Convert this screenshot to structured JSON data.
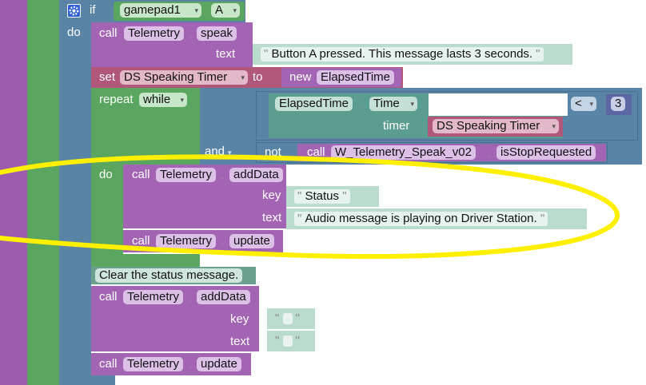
{
  "event": {
    "do_label": "do"
  },
  "if_block": {
    "if_label": "if",
    "do_label": "do",
    "condition": {
      "object": "gamepad1",
      "property": "A"
    }
  },
  "speak_block": {
    "call_label": "call",
    "object": "Telemetry",
    "method": "speak",
    "text_label": "text",
    "text_value": "Button A pressed. This message lasts 3 seconds."
  },
  "set_block": {
    "set_label": "set",
    "variable": "DS Speaking Timer",
    "to_label": "to",
    "new_label": "new",
    "class_name": "ElapsedTime"
  },
  "repeat_block": {
    "repeat_label": "repeat",
    "mode": "while",
    "do_label": "do",
    "compare": {
      "object": "ElapsedTime",
      "property": "Time",
      "timer_label": "timer",
      "timer_value": "DS Speaking Timer",
      "operator": "<",
      "number": "3"
    },
    "and_label": "and",
    "not_label": "not",
    "not_call": {
      "call_label": "call",
      "function": "W_Telemetry_Speak_v02",
      "method": "isStopRequested"
    }
  },
  "loop_body": {
    "add_data": {
      "call_label": "call",
      "object": "Telemetry",
      "method": "addData",
      "key_label": "key",
      "key_value": "Status",
      "text_label": "text",
      "text_value": "Audio message is playing on Driver Station."
    },
    "update": {
      "call_label": "call",
      "object": "Telemetry",
      "method": "update"
    }
  },
  "comment": "Clear the status message.",
  "clear_block": {
    "add_data": {
      "call_label": "call",
      "object": "Telemetry",
      "method": "addData",
      "key_label": "key",
      "key_value": "",
      "text_label": "text",
      "text_value": ""
    },
    "update": {
      "call_label": "call",
      "object": "Telemetry",
      "method": "update"
    }
  },
  "colors": {
    "purple": "#9d5dad",
    "green": "#5aa55f",
    "blue": "#5a84a6",
    "teal": "#5b9e8f",
    "set": "#b0577a",
    "highlight": "#ffef00"
  }
}
